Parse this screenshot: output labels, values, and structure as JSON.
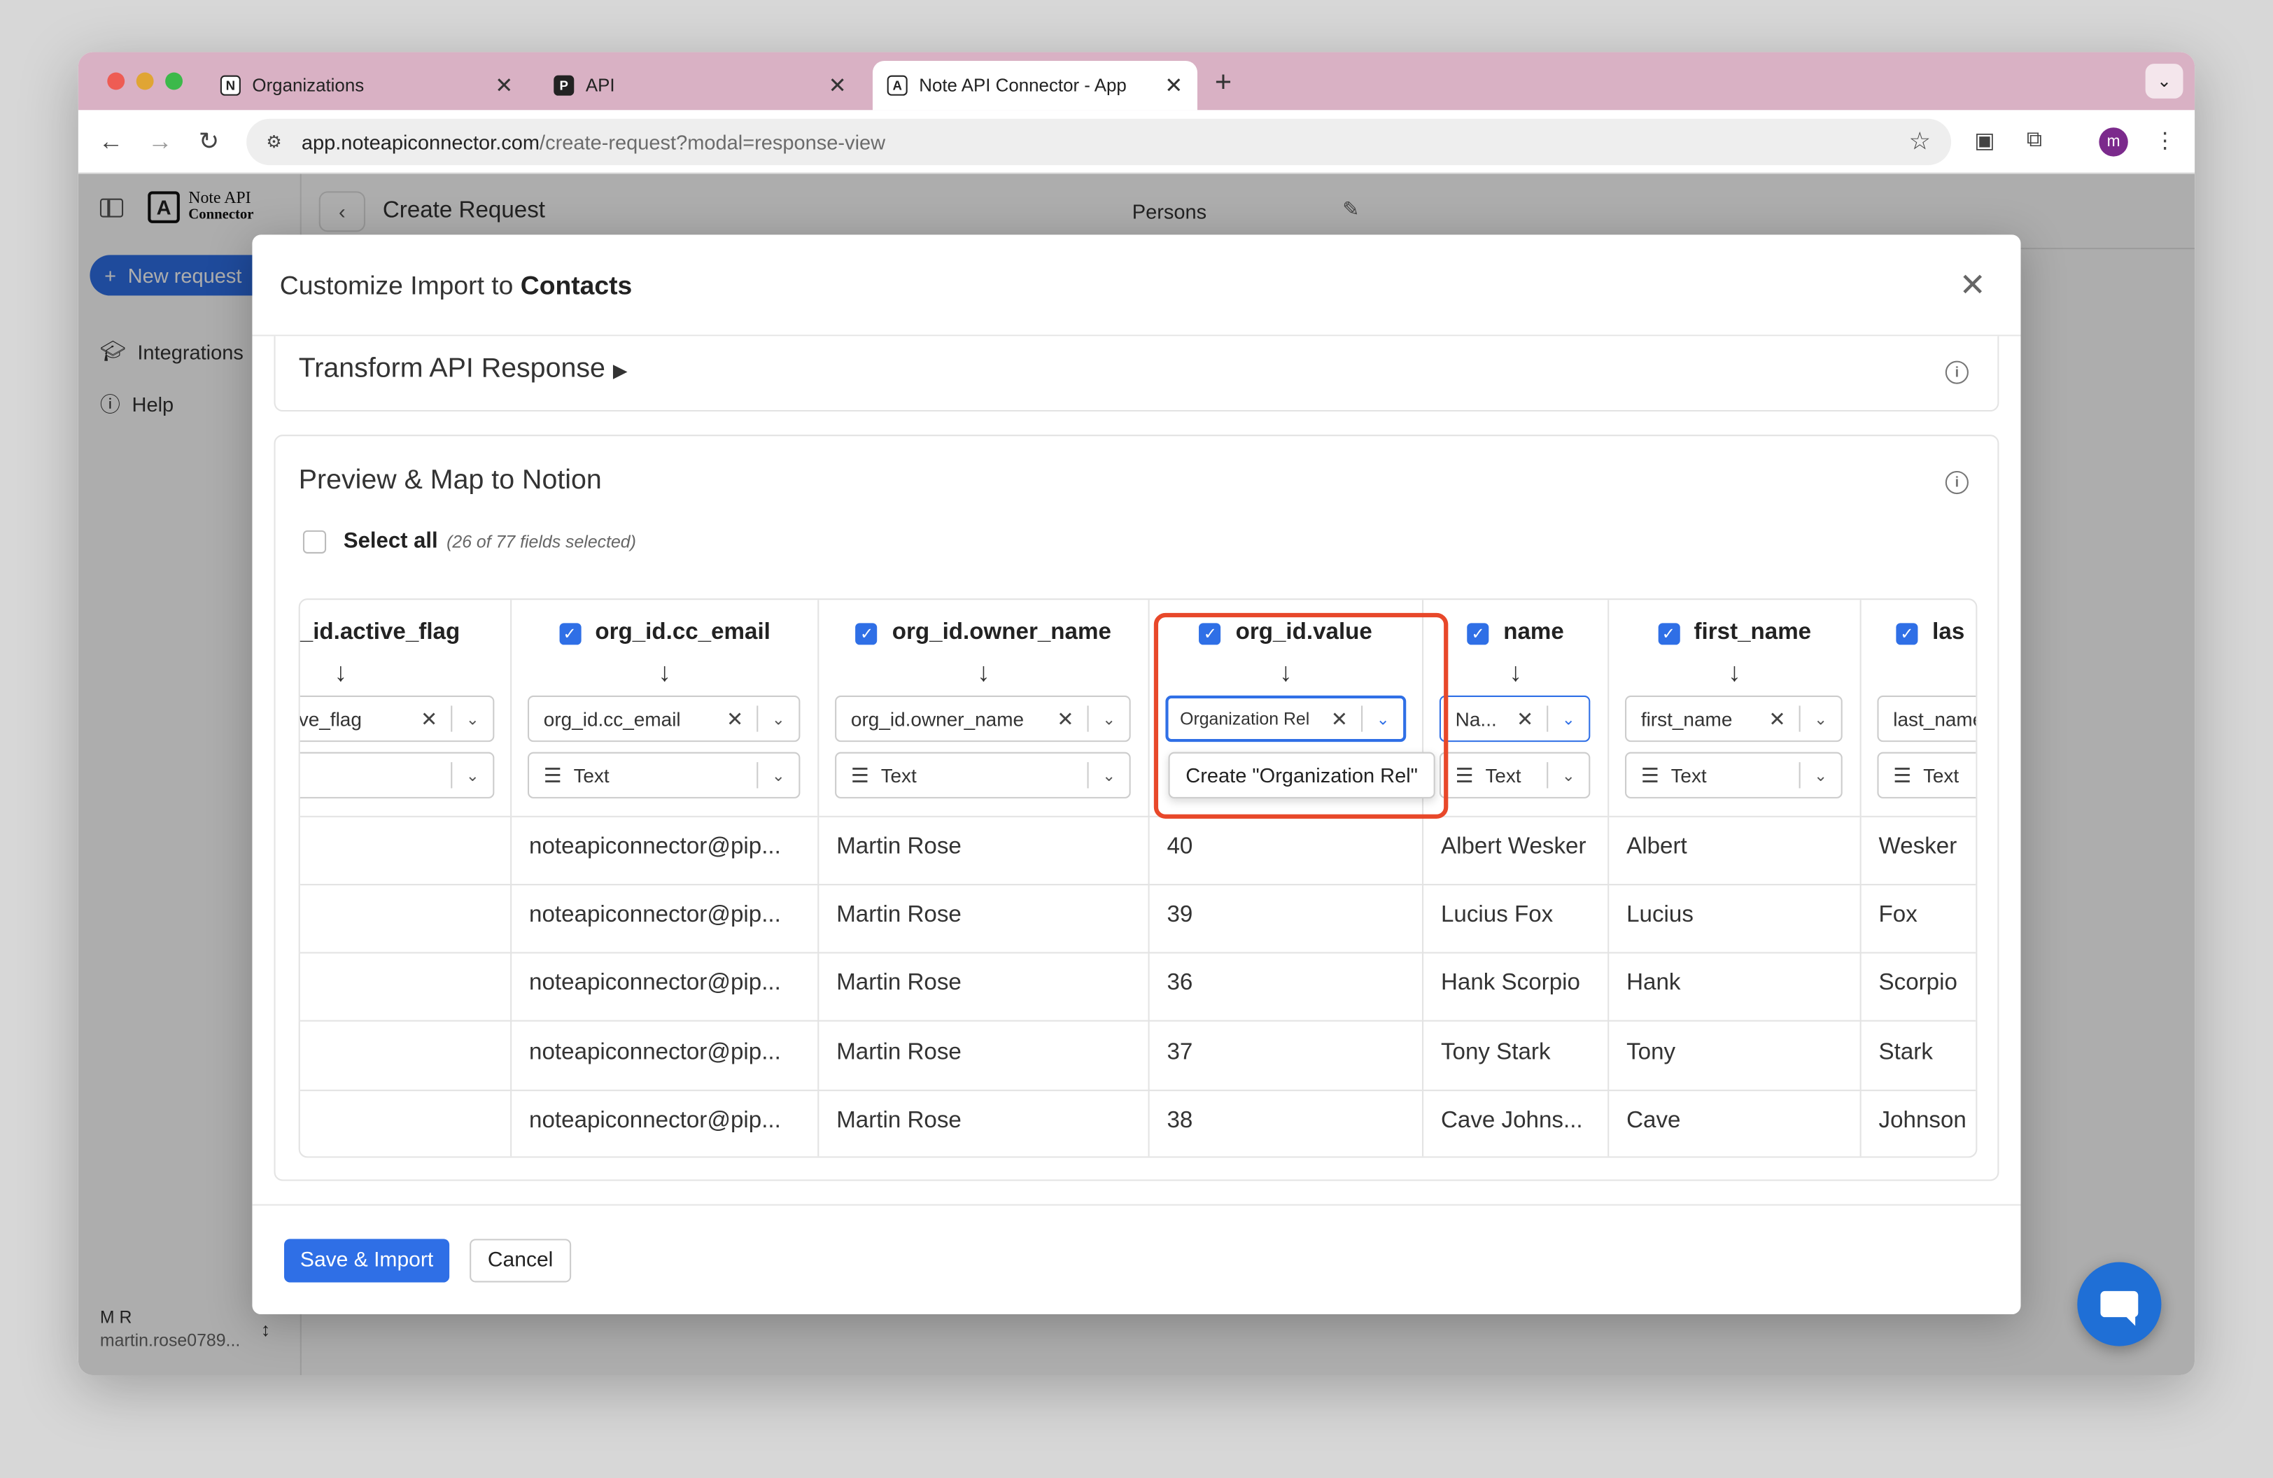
{
  "browser": {
    "tabs": [
      {
        "label": "Organizations",
        "favicon": "N"
      },
      {
        "label": "API",
        "favicon": "P"
      },
      {
        "label": "Note API Connector - App",
        "favicon": "A"
      }
    ],
    "url_host": "app.noteapiconnector.com",
    "url_path": "/create-request?modal=response-view",
    "profile_initial": "m"
  },
  "sidebar": {
    "logo_line1": "Note API",
    "logo_line2": "Connector",
    "new_request": "New request",
    "items": [
      {
        "label": "Integrations",
        "icon": "graduation-cap-icon"
      },
      {
        "label": "Help",
        "icon": "question-circle-icon"
      }
    ],
    "user_initials": "M R",
    "user_email": "martin.rose0789..."
  },
  "topbar": {
    "title": "Create Request",
    "database": "Persons"
  },
  "modal": {
    "title_prefix": "Customize Import to ",
    "title_target": "Contacts",
    "transform_title": "Transform API Response",
    "preview_title": "Preview & Map to Notion",
    "select_all": "Select all",
    "selection_count": "(26 of 77 fields selected)",
    "save_button": "Save & Import",
    "cancel_button": "Cancel"
  },
  "columns": [
    {
      "header": "_id.active_flag",
      "checked": null,
      "mapping": "ve_flag",
      "type": "",
      "cells": [
        "",
        "",
        "",
        "",
        ""
      ]
    },
    {
      "header": "org_id.cc_email",
      "checked": true,
      "mapping": "org_id.cc_email",
      "type": "Text",
      "cells": [
        "noteapiconnector@pip...",
        "noteapiconnector@pip...",
        "noteapiconnector@pip...",
        "noteapiconnector@pip...",
        "noteapiconnector@pip..."
      ]
    },
    {
      "header": "org_id.owner_name",
      "checked": true,
      "mapping": "org_id.owner_name",
      "type": "Text",
      "cells": [
        "Martin Rose",
        "Martin Rose",
        "Martin Rose",
        "Martin Rose",
        "Martin Rose"
      ]
    },
    {
      "header": "org_id.value",
      "checked": true,
      "mapping": "Organization Rel",
      "type": "",
      "cells": [
        "40",
        "39",
        "36",
        "37",
        "38"
      ]
    },
    {
      "header": "name",
      "checked": true,
      "mapping": "Na...",
      "type": "Text",
      "cells": [
        "Albert Wesker",
        "Lucius Fox",
        "Hank Scorpio",
        "Tony Stark",
        "Cave Johns..."
      ]
    },
    {
      "header": "first_name",
      "checked": true,
      "mapping": "first_name",
      "type": "Text",
      "cells": [
        "Albert",
        "Lucius",
        "Hank",
        "Tony",
        "Cave"
      ]
    },
    {
      "header": "las",
      "checked": true,
      "mapping": "last_name",
      "type": "Text",
      "cells": [
        "Wesker",
        "Fox",
        "Scorpio",
        "Stark",
        "Johnson"
      ]
    }
  ],
  "dropdown_option": "Create \"Organization Rel\"",
  "colors": {
    "accent": "#2f6fe6",
    "highlight": "#e8482a",
    "tabstrip": "#d9b1c4"
  }
}
